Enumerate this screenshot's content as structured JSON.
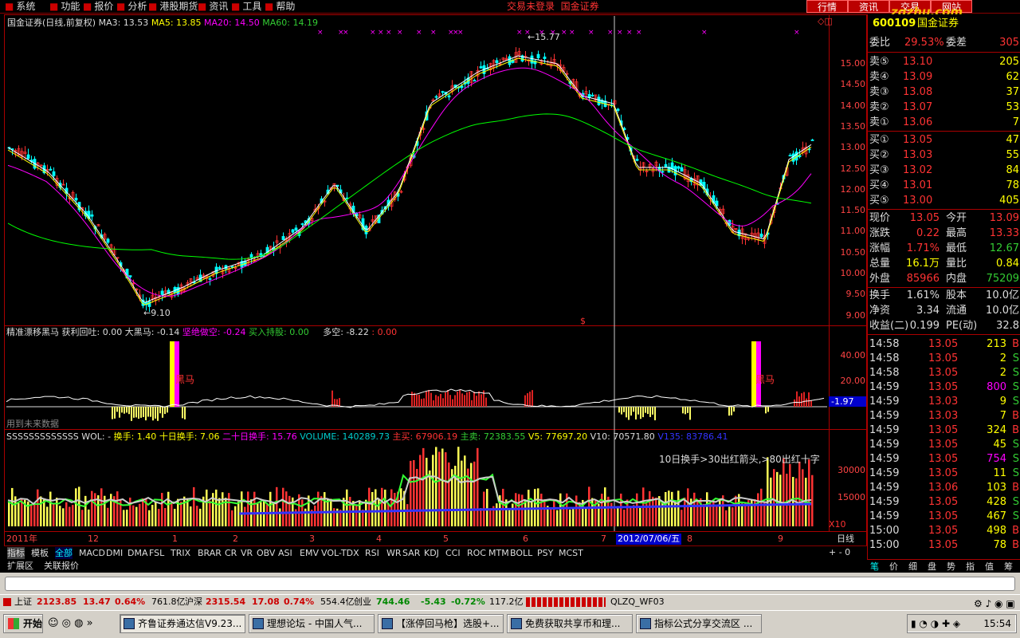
{
  "menu": {
    "items": [
      "系统",
      "功能",
      "报价",
      "分析",
      "港股期货",
      "资讯",
      "工具",
      "帮助"
    ],
    "trade_status": "交易未登录",
    "broker": "国金证券",
    "top_buttons": [
      "行情",
      "资讯",
      "交易",
      "网站"
    ],
    "watermark": "zgzhu.com"
  },
  "main_chart": {
    "header": "国金证券(日线,前复权)",
    "ma3": "MA3: 13.53",
    "ma5": "MA5: 13.85",
    "ma20": "MA20: 14.50",
    "ma60": "MA60: 14.19",
    "high_marker": "15.77",
    "low_marker": "9.10",
    "y_ticks": [
      "15.00",
      "14.50",
      "14.00",
      "13.50",
      "13.00",
      "12.50",
      "12.00",
      "11.50",
      "11.00",
      "10.50",
      "10.00",
      "9.50",
      "9.00"
    ],
    "colors": {
      "ma3": "#ffffff",
      "ma5": "#ffff00",
      "ma20": "#ff00ff",
      "ma60": "#00ff00",
      "up": "#ff3333",
      "down": "#00ffff"
    }
  },
  "indicator": {
    "name": "精准漂移黑马",
    "f1": "获利回吐: 0.00",
    "f2": "大黑马: -0.14",
    "f3": "坚绝做空: -0.24",
    "f4": "买入持股: 0.00",
    "f5": "多空: -8.22",
    "f6": ": 0.00",
    "warn": "用到未来数据",
    "tag1": "黑马",
    "tag2": "黑马",
    "y_ticks": [
      "40.00",
      "20.00"
    ],
    "current": "-1.97"
  },
  "volume": {
    "header": "SSSSSSSSSSSSS WOL: -",
    "f1": "换手: 1.40",
    "f2": "十日换手: 7.06",
    "f3": "二十日换手: 15.76",
    "f4": "VOLUME: 140289.73",
    "f5": "主买: 67906.19",
    "f6": "主卖: 72383.55",
    "f7": "V5: 77697.20",
    "f8": "V10: 70571.80",
    "f9": "V135: 83786.41",
    "note": "10日换手>30出红箭头,>80出红十字",
    "y_ticks": [
      "30000",
      "15000"
    ],
    "unit": "X10"
  },
  "x_axis": {
    "labels": [
      "2011年",
      "12",
      "1",
      "2",
      "3",
      "4",
      "5",
      "6",
      "7",
      "8",
      "9"
    ],
    "cursor_date": "2012/07/06/五",
    "period": "日线"
  },
  "tabs": [
    "指标",
    "模板",
    "全部",
    "MACD",
    "DMI",
    "DMA",
    "FSL",
    "TRIX",
    "BRAR",
    "CR",
    "VR",
    "OBV",
    "ASI",
    "EMV",
    "VOL-TDX",
    "RSI",
    "WR",
    "SAR",
    "KDJ",
    "CCI",
    "ROC",
    "MTM",
    "BOLL",
    "PSY",
    "MCST"
  ],
  "tabs2": [
    "扩展区",
    "关联报价"
  ],
  "quote": {
    "code": "600109",
    "name": "国金证券",
    "weibi_label": "委比",
    "weibi": "29.53%",
    "weicha_label": "委差",
    "weicha": "305",
    "asks": [
      {
        "label": "卖⑤",
        "price": "13.10",
        "vol": "205"
      },
      {
        "label": "卖④",
        "price": "13.09",
        "vol": "62"
      },
      {
        "label": "卖③",
        "price": "13.08",
        "vol": "37"
      },
      {
        "label": "卖②",
        "price": "13.07",
        "vol": "53"
      },
      {
        "label": "卖①",
        "price": "13.06",
        "vol": "7"
      }
    ],
    "bids": [
      {
        "label": "买①",
        "price": "13.05",
        "vol": "47"
      },
      {
        "label": "买②",
        "price": "13.03",
        "vol": "55"
      },
      {
        "label": "买③",
        "price": "13.02",
        "vol": "84"
      },
      {
        "label": "买④",
        "price": "13.01",
        "vol": "78"
      },
      {
        "label": "买⑤",
        "price": "13.00",
        "vol": "405"
      }
    ],
    "stats": [
      {
        "l1": "现价",
        "v1": "13.05",
        "l2": "今开",
        "v2": "13.09",
        "c1": "r",
        "c2": "r"
      },
      {
        "l1": "涨跌",
        "v1": "0.22",
        "l2": "最高",
        "v2": "13.33",
        "c1": "r",
        "c2": "r"
      },
      {
        "l1": "涨幅",
        "v1": "1.71%",
        "l2": "最低",
        "v2": "12.67",
        "c1": "r",
        "c2": "g"
      },
      {
        "l1": "总量",
        "v1": "16.1万",
        "l2": "量比",
        "v2": "0.84",
        "c1": "y",
        "c2": "y"
      },
      {
        "l1": "外盘",
        "v1": "85966",
        "l2": "内盘",
        "v2": "75209",
        "c1": "r",
        "c2": "g"
      },
      {
        "l1": "换手",
        "v1": "1.61%",
        "l2": "股本",
        "v2": "10.0亿",
        "c1": "w",
        "c2": "w"
      },
      {
        "l1": "净资",
        "v1": "3.34",
        "l2": "流通",
        "v2": "10.0亿",
        "c1": "w",
        "c2": "w"
      },
      {
        "l1": "收益(二)",
        "v1": "0.199",
        "l2": "PE(动)",
        "v2": "32.8",
        "c1": "w",
        "c2": "w"
      }
    ],
    "ticks": [
      {
        "t": "14:58",
        "p": "13.05",
        "v": "213",
        "s": "B"
      },
      {
        "t": "14:58",
        "p": "13.05",
        "v": "2",
        "s": "S"
      },
      {
        "t": "14:58",
        "p": "13.05",
        "v": "2",
        "s": "S"
      },
      {
        "t": "14:59",
        "p": "13.05",
        "v": "800",
        "s": "S"
      },
      {
        "t": "14:59",
        "p": "13.03",
        "v": "9",
        "s": "S"
      },
      {
        "t": "14:59",
        "p": "13.03",
        "v": "7",
        "s": "B"
      },
      {
        "t": "14:59",
        "p": "13.05",
        "v": "324",
        "s": "B"
      },
      {
        "t": "14:59",
        "p": "13.05",
        "v": "45",
        "s": "S"
      },
      {
        "t": "14:59",
        "p": "13.05",
        "v": "754",
        "s": "S"
      },
      {
        "t": "14:59",
        "p": "13.05",
        "v": "11",
        "s": "S"
      },
      {
        "t": "14:59",
        "p": "13.06",
        "v": "103",
        "s": "B"
      },
      {
        "t": "14:59",
        "p": "13.05",
        "v": "428",
        "s": "S"
      },
      {
        "t": "14:59",
        "p": "13.05",
        "v": "467",
        "s": "S"
      },
      {
        "t": "15:00",
        "p": "13.05",
        "v": "498",
        "s": "B"
      },
      {
        "t": "15:00",
        "p": "13.05",
        "v": "78",
        "s": "B"
      }
    ],
    "bottom_tabs": [
      "笔",
      "价",
      "细",
      "盘",
      "势",
      "指",
      "值",
      "筹"
    ]
  },
  "statusbar": {
    "sh_label": "上证",
    "sh": "2123.85",
    "sh_chg": "13.47",
    "sh_pct": "0.64%",
    "sh_amt": "761.8亿",
    "sz_label": "沪深",
    "sz": "2315.54",
    "sz_chg": "17.08",
    "sz_pct": "0.74%",
    "sz_amt": "554.4亿",
    "cy_label": "创业",
    "cy": "744.46",
    "cy_chg": "-5.43",
    "cy_pct": "-0.72%",
    "cy_amt": "117.2亿",
    "server": "QLZQ_WF03"
  },
  "taskbar": {
    "start": "开始",
    "tasks": [
      "齐鲁证券通达信V9.23...",
      "理想论坛 - 中国人气...",
      "【涨停回马枪】选股+...",
      "免费获取共享币和理...",
      "指标公式分享交流区 ..."
    ],
    "clock": "15:54"
  }
}
